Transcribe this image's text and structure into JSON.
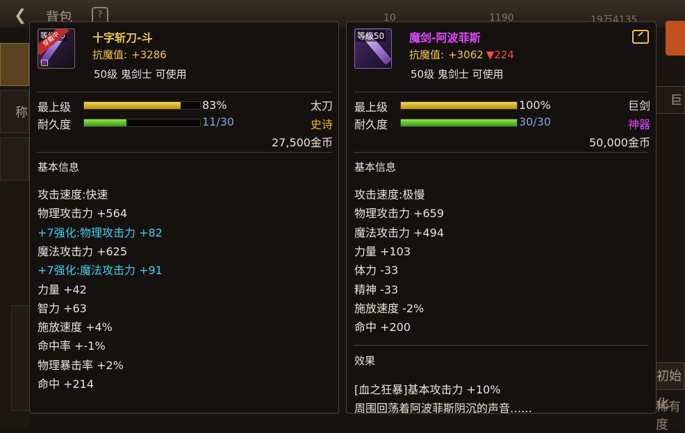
{
  "background": {
    "title": "背包",
    "help": "?",
    "resources": [
      "10",
      "1190",
      "19万4135"
    ],
    "side_tab": "称",
    "right_tab": "巨",
    "right_button": "初始化",
    "right_text": "稀有度"
  },
  "left_item": {
    "level_tag": "等级50",
    "equipped_badge": "穿戴中",
    "name": "十字斩刀-斗",
    "name_color": "#f2c74a",
    "enchant_label": "抗魔值:",
    "enchant_value": "+3286",
    "requirement": "50级 鬼剑士 可使用",
    "grade_label": "最上级",
    "grade_pct": "83%",
    "grade_fill": 0.83,
    "weapon_type": "太刀",
    "durability_label": "耐久度",
    "durability_value": "11/30",
    "durability_fill": 0.367,
    "rarity": "史诗",
    "rarity_color": "#f2b233",
    "price": "27,500金币",
    "section": "基本信息",
    "stats": [
      {
        "text": "攻击速度:快速",
        "color": "#e9e3d8"
      },
      {
        "text": "物理攻击力 +564",
        "color": "#e9e3d8"
      },
      {
        "text": "+7强化:物理攻击力 +82",
        "color": "#3fd0f0"
      },
      {
        "text": "魔法攻击力 +625",
        "color": "#e9e3d8"
      },
      {
        "text": "+7强化:魔法攻击力 +91",
        "color": "#3fd0f0"
      },
      {
        "text": "力量 +42",
        "color": "#e9e3d8"
      },
      {
        "text": "智力 +63",
        "color": "#e9e3d8"
      },
      {
        "text": "施放速度 +4%",
        "color": "#e9e3d8"
      },
      {
        "text": "命中率 +-1%",
        "color": "#e9e3d8"
      },
      {
        "text": "物理暴击率 +2%",
        "color": "#e9e3d8"
      },
      {
        "text": "命中 +214",
        "color": "#e9e3d8"
      }
    ]
  },
  "right_item": {
    "level_tag": "等级50",
    "name": "魔剑-阿波菲斯",
    "name_color": "#e048ff",
    "enchant_label": "抗魔值:",
    "enchant_value": "+3062",
    "enchant_diff": "▼224",
    "requirement": "50级 鬼剑士 可使用",
    "grade_label": "最上级",
    "grade_pct": "100%",
    "grade_fill": 1.0,
    "weapon_type": "巨剑",
    "durability_label": "耐久度",
    "durability_value": "30/30",
    "durability_fill": 1.0,
    "rarity": "神器",
    "rarity_color": "#e048ff",
    "price": "50,000金币",
    "section": "基本信息",
    "stats": [
      {
        "text": "攻击速度:极慢",
        "color": "#e9e3d8"
      },
      {
        "text": "物理攻击力 +659",
        "color": "#e9e3d8"
      },
      {
        "text": "魔法攻击力 +494",
        "color": "#e9e3d8"
      },
      {
        "text": "力量 +103",
        "color": "#e9e3d8"
      },
      {
        "text": "体力 -33",
        "color": "#e9e3d8"
      },
      {
        "text": "精神 -33",
        "color": "#e9e3d8"
      },
      {
        "text": "施放速度 -2%",
        "color": "#e9e3d8"
      },
      {
        "text": "命中 +200",
        "color": "#e9e3d8"
      }
    ],
    "effect_title": "效果",
    "effects": [
      "[血之狂暴]基本攻击力 +10%",
      "周围回荡着阿波菲斯阴沉的声音……"
    ]
  }
}
